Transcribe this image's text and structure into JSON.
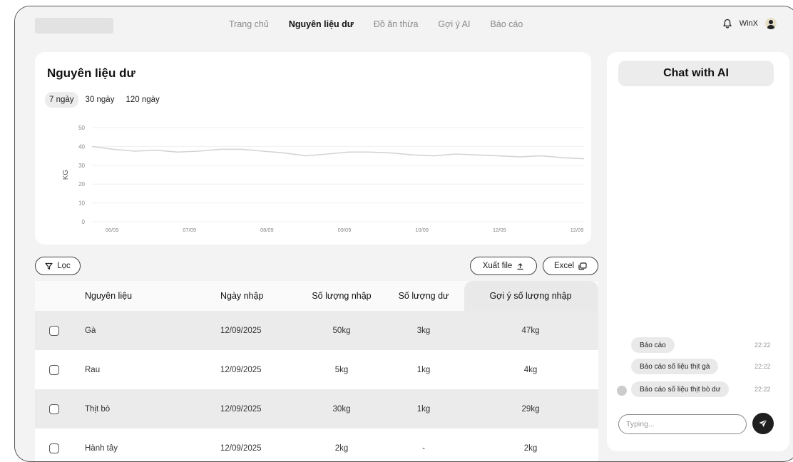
{
  "nav": {
    "items": [
      {
        "label": "Trang chủ",
        "active": false
      },
      {
        "label": "Nguyên liệu dư",
        "active": true
      },
      {
        "label": "Đồ ăn thừa",
        "active": false
      },
      {
        "label": "Gợi ý AI",
        "active": false
      },
      {
        "label": "Báo cáo",
        "active": false
      }
    ],
    "user": "WinX",
    "icons": {
      "bell": "bell-icon",
      "avatar": "user-avatar"
    }
  },
  "page": {
    "title": "Nguyên liệu dư",
    "ranges": [
      {
        "label": "7 ngày",
        "active": true
      },
      {
        "label": "30 ngày",
        "active": false
      },
      {
        "label": "120 ngày",
        "active": false
      }
    ]
  },
  "chart_data": {
    "type": "line",
    "title": "",
    "xlabel": "",
    "ylabel": "KG",
    "ylim": [
      0,
      50
    ],
    "yticks": [
      0,
      10,
      20,
      30,
      40,
      50
    ],
    "x_ticks": [
      "06/09",
      "07/09",
      "08/09",
      "09/09",
      "10/09",
      "12/09",
      "12/09"
    ],
    "grid": true,
    "series": [
      {
        "color": "#d4d4d4",
        "values": [
          40,
          38.5,
          37.5,
          38,
          37,
          37.5,
          38.5,
          38.5,
          37.5,
          36.5,
          35,
          36,
          37,
          37,
          36.5,
          35.5,
          35,
          36,
          35.5,
          35,
          34.5,
          35,
          34,
          33.5
        ]
      }
    ]
  },
  "toolbar": {
    "filter_label": "Lọc",
    "export_label": "Xuất file",
    "excel_label": "Excel"
  },
  "table": {
    "columns": [
      "",
      "Nguyên liệu",
      "Ngày nhập",
      "Số lượng nhập",
      "Số lượng dư",
      "Gợi ý số lượng nhập"
    ],
    "rows": [
      {
        "name": "Gà",
        "date": "12/09/2025",
        "qty": "50kg",
        "left": "3kg",
        "suggest": "47kg"
      },
      {
        "name": "Rau",
        "date": "12/09/2025",
        "qty": "5kg",
        "left": "1kg",
        "suggest": "4kg"
      },
      {
        "name": "Thịt bò",
        "date": "12/09/2025",
        "qty": "30kg",
        "left": "1kg",
        "suggest": "29kg"
      },
      {
        "name": "Hành tây",
        "date": "12/09/2025",
        "qty": "2kg",
        "left": "-",
        "suggest": "2kg"
      }
    ]
  },
  "chat": {
    "title": "Chat with AI",
    "messages": [
      {
        "text": "Báo cáo",
        "time": "22:22"
      },
      {
        "text": "Báo cáo số liệu thịt gà",
        "time": "22:22"
      },
      {
        "text": "Báo cáo số liệu thịt bò dư",
        "time": "22:22"
      }
    ],
    "input_placeholder": "Typing..."
  }
}
